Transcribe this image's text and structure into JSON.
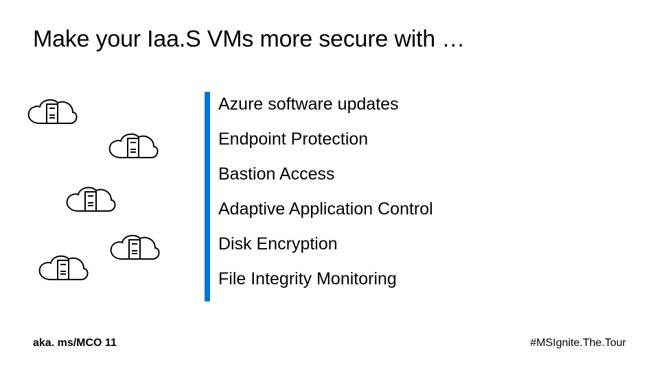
{
  "title": "Make your Iaa.S VMs more secure with …",
  "features": [
    "Azure software updates",
    "Endpoint Protection",
    "Bastion Access",
    "Adaptive Application Control",
    "Disk Encryption",
    "File Integrity Monitoring"
  ],
  "footer": {
    "left": "aka. ms/MCO 11",
    "right": "#MSIgnite.The.Tour"
  },
  "colors": {
    "accent": "#0078D4"
  }
}
